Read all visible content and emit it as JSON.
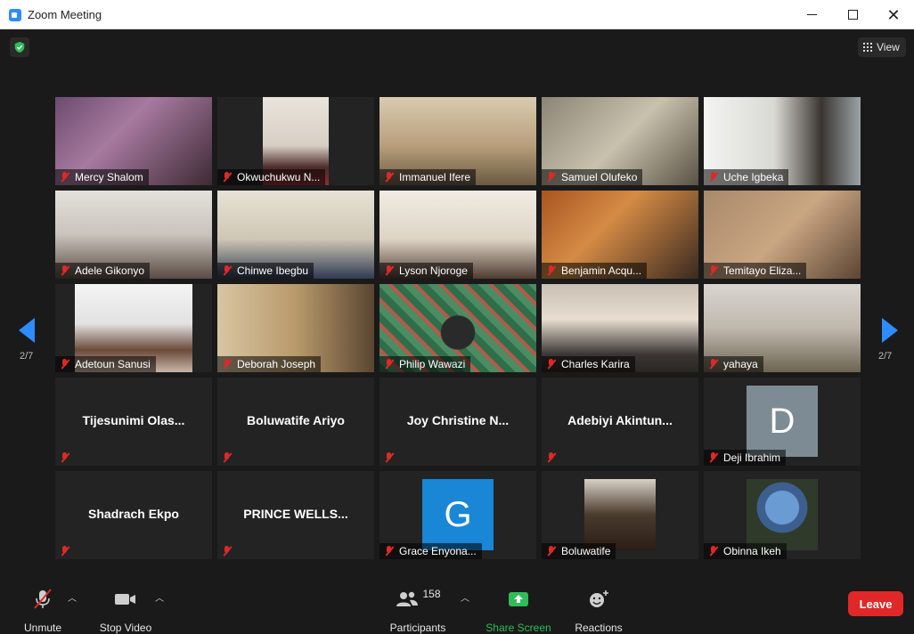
{
  "window": {
    "title": "Zoom Meeting"
  },
  "top_bar": {
    "view_label": "View"
  },
  "pagination": {
    "left": "2/7",
    "right": "2/7"
  },
  "tiles": [
    {
      "name": "Mercy Shalom"
    },
    {
      "name": "Okwuchukwu N..."
    },
    {
      "name": "Immanuel Ifere"
    },
    {
      "name": "Samuel Olufeko"
    },
    {
      "name": "Uche Igbeka"
    },
    {
      "name": "Adele Gikonyo"
    },
    {
      "name": "Chinwe Ibegbu"
    },
    {
      "name": "Lyson Njoroge"
    },
    {
      "name": "Benjamin Acqu..."
    },
    {
      "name": "Temitayo Eliza..."
    },
    {
      "name": "Adetoun Sanusi"
    },
    {
      "name": "Deborah Joseph"
    },
    {
      "name": "Philip Wawazi"
    },
    {
      "name": "Charles Karira"
    },
    {
      "name": "yahaya"
    },
    {
      "name": "Tijesunimi  Olas..."
    },
    {
      "name": "Boluwatife Ariyo"
    },
    {
      "name": "Joy  Christine  N..."
    },
    {
      "name": "Adebiyi  Akintun..."
    },
    {
      "name": "Deji Ibrahim",
      "avatar_letter": "D",
      "avatar_color": "#7d8c94"
    },
    {
      "name": "Shadrach Ekpo"
    },
    {
      "name": "PRINCE  WELLS..."
    },
    {
      "name": "Grace Enyona...",
      "avatar_letter": "G",
      "avatar_color": "#1a86d6"
    },
    {
      "name": "Boluwatife"
    },
    {
      "name": "Obinna Ikeh"
    }
  ],
  "toolbar": {
    "unmute_label": "Unmute",
    "stop_video_label": "Stop Video",
    "participants_label": "Participants",
    "participants_count": "158",
    "share_screen_label": "Share Screen",
    "reactions_label": "Reactions",
    "leave_label": "Leave"
  },
  "colors": {
    "accent": "#2d8cff",
    "leave": "#e02828",
    "share": "#2ebd59",
    "muted": "#e02828"
  }
}
